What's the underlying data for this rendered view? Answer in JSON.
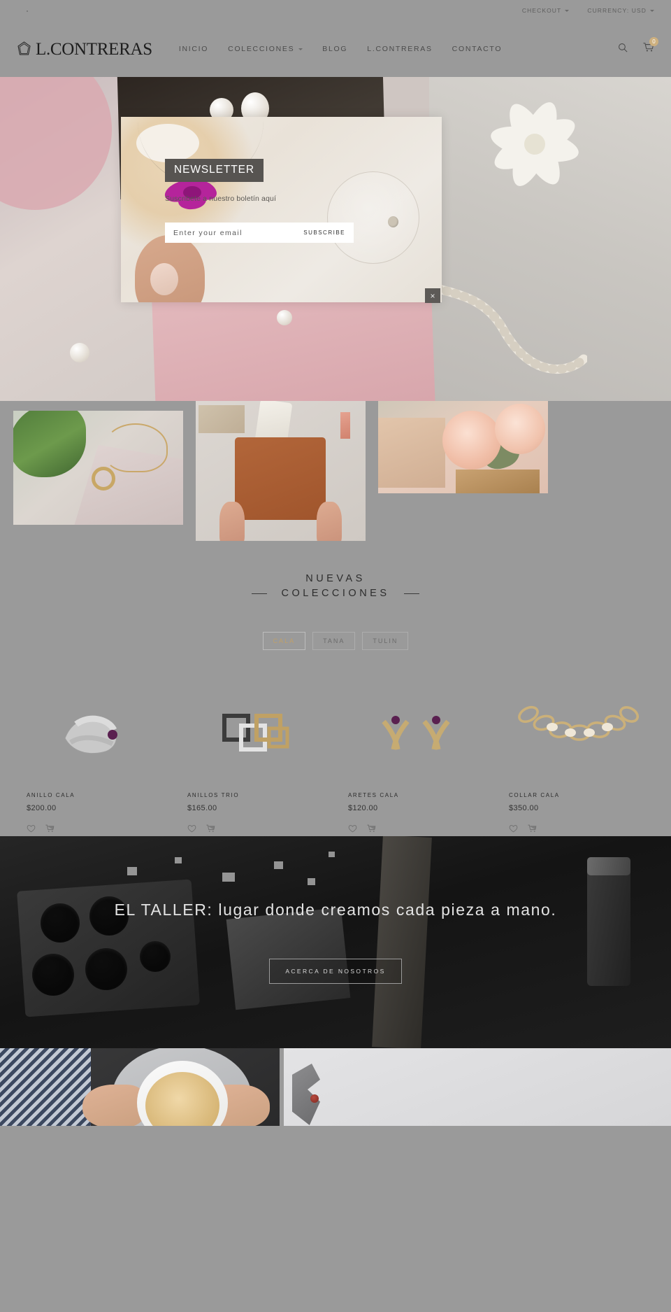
{
  "topbar": {
    "checkout": "CHECKOUT",
    "currency": "CURRENCY: USD"
  },
  "header": {
    "logo_text": "L.CONTRERAS",
    "nav": [
      {
        "label": "INICIO",
        "has_caret": false
      },
      {
        "label": "COLECCIONES",
        "has_caret": true
      },
      {
        "label": "BLOG",
        "has_caret": false
      },
      {
        "label": "L.CONTRERAS",
        "has_caret": false
      },
      {
        "label": "CONTACTO",
        "has_caret": false
      }
    ],
    "cart_count": "0",
    "accent_color": "#cdb07f"
  },
  "newsletter": {
    "badge": "NEWSLETTER",
    "subtitle": "Suscribete a nuestro boletín aquí",
    "email_placeholder": "Enter your email",
    "email_value": "",
    "submit_label": "SUBSCRIBE",
    "close_label": "×"
  },
  "collections": {
    "title_line1": "NUEVAS",
    "title_line2": "COLECCIONES",
    "filters": [
      {
        "label": "CALA",
        "active": true
      },
      {
        "label": "TANA",
        "active": false
      },
      {
        "label": "TULIN",
        "active": false
      }
    ],
    "products": [
      {
        "name": "ANILLO CALA",
        "price": "$200.00"
      },
      {
        "name": "ANILLOS TRIO",
        "price": "$165.00"
      },
      {
        "name": "ARETES CALA",
        "price": "$120.00"
      },
      {
        "name": "COLLAR CALA",
        "price": "$350.00"
      }
    ],
    "wishlist_icon": "heart-icon",
    "cart_icon": "cart-icon"
  },
  "taller": {
    "headline": "EL TALLER: lugar donde creamos cada pieza a mano.",
    "button_label": "ACERCA DE NOSOTROS"
  }
}
